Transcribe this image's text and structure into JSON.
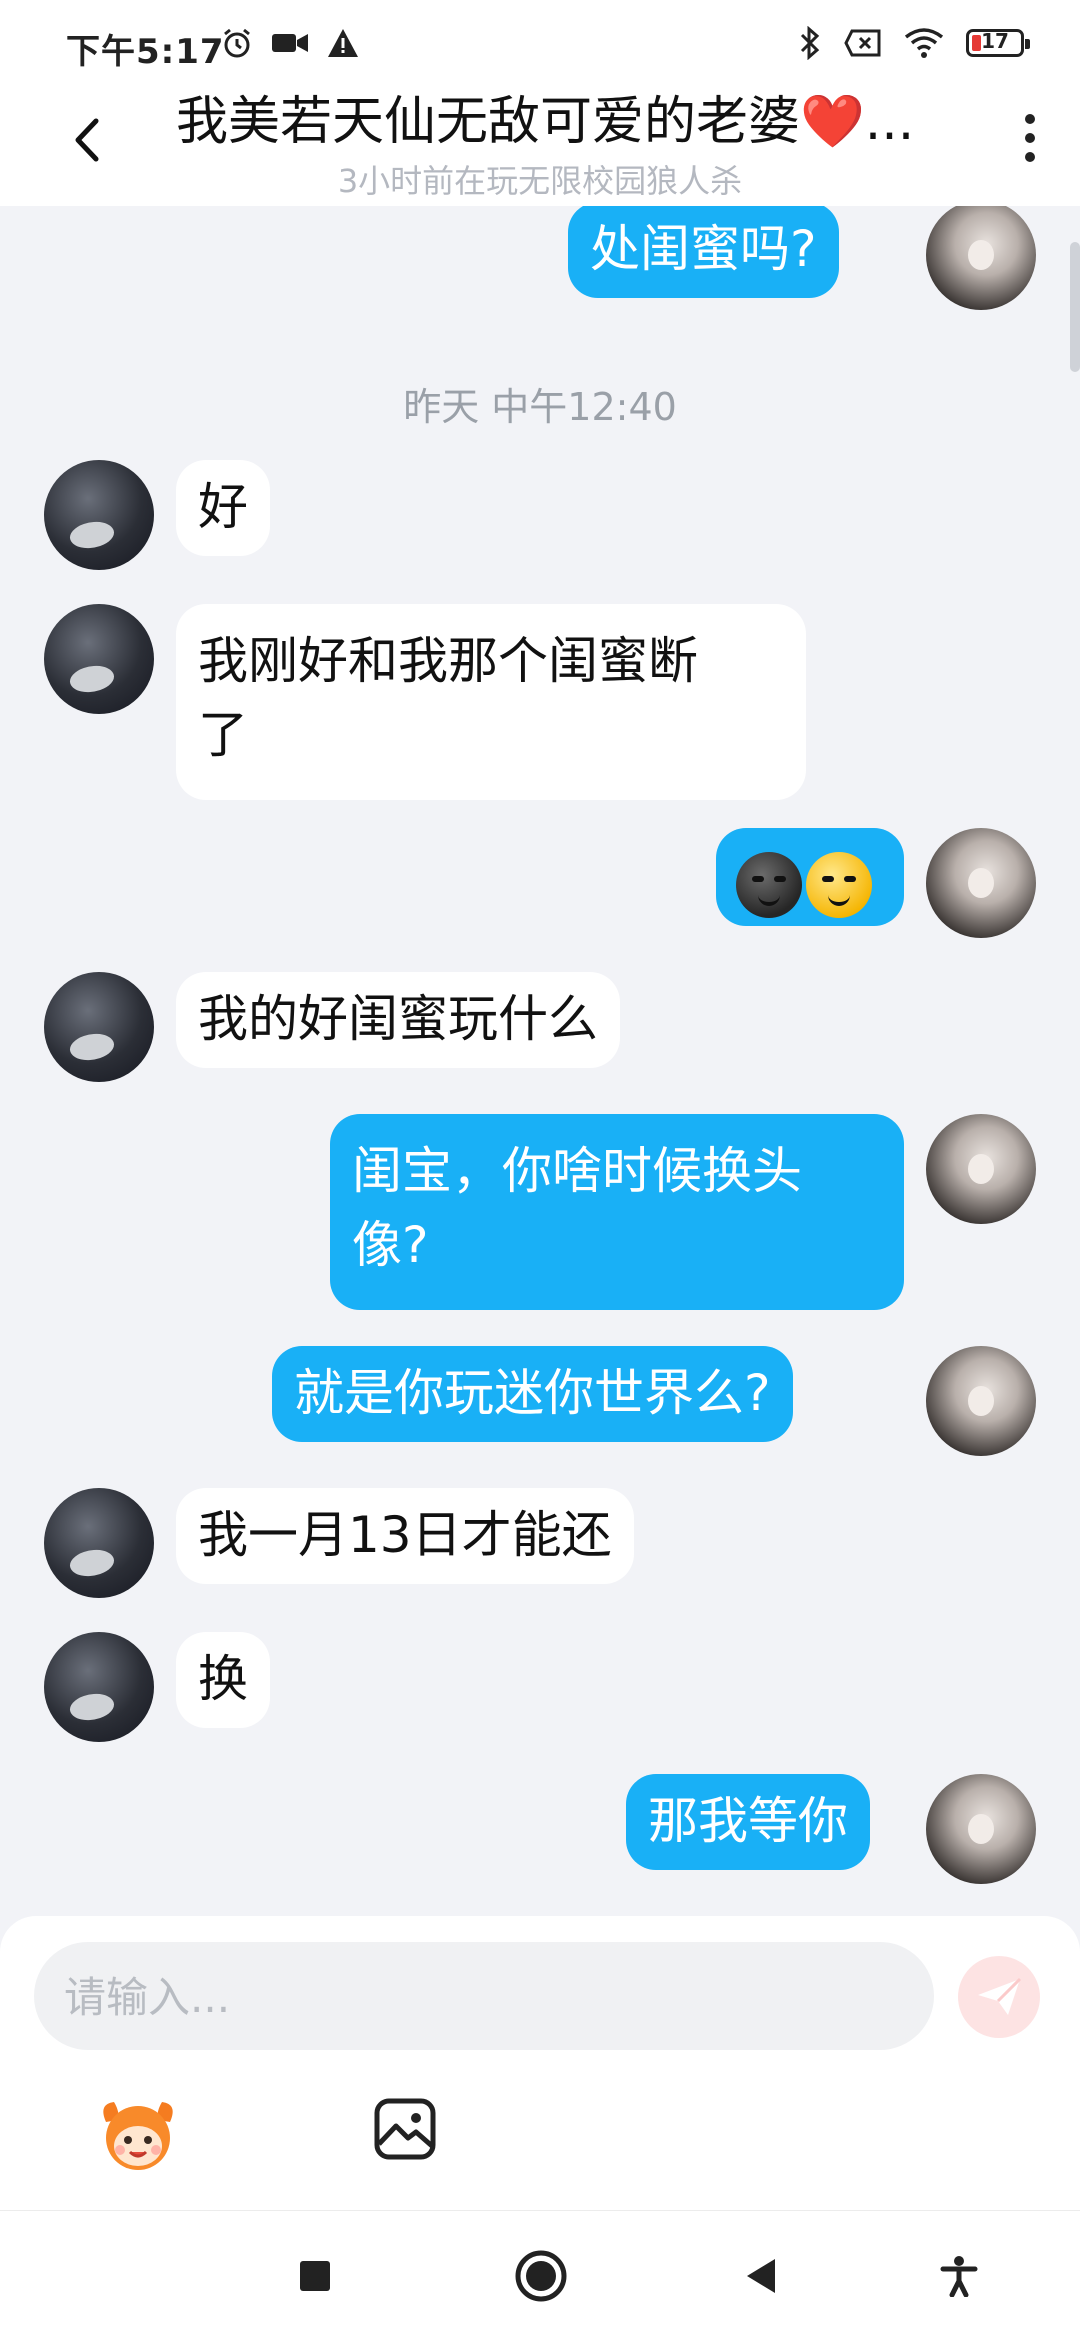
{
  "status_bar": {
    "time": "下午5:17",
    "battery_level": "17",
    "icons": [
      "alarm-icon",
      "video-camera-icon",
      "warning-icon",
      "bluetooth-icon",
      "sim-blocked-icon",
      "wifi-icon",
      "battery-icon"
    ]
  },
  "header": {
    "title": "我美若天仙无敌可爱的老婆❤️...",
    "subtitle": "3小时前在玩无限校园狼人杀"
  },
  "chat": {
    "timestamp": "昨天 中午12:40",
    "messages": [
      {
        "sender": "self",
        "text": "处闺蜜吗?"
      },
      {
        "sender": "other",
        "text": "好"
      },
      {
        "sender": "other",
        "line1": "我刚好和我那个闺蜜断",
        "line2": "了"
      },
      {
        "sender": "self",
        "emojis": [
          "dark-smirk-emoji",
          "smirk-emoji"
        ]
      },
      {
        "sender": "other",
        "text": "我的好闺蜜玩什么"
      },
      {
        "sender": "self",
        "line1": "闺宝，你啥时候换头",
        "line2": "像?"
      },
      {
        "sender": "self",
        "text": "就是你玩迷你世界么?"
      },
      {
        "sender": "other",
        "text": "我一月13日才能还"
      },
      {
        "sender": "other",
        "text": "换"
      },
      {
        "sender": "self",
        "text": "那我等你"
      }
    ]
  },
  "input": {
    "placeholder": "请输入...",
    "value": ""
  },
  "colors": {
    "outgoing_bubble": "#19b0f6",
    "incoming_bubble": "#ffffff",
    "background": "#f2f3f7",
    "send_button_bg": "#fde3e3"
  }
}
